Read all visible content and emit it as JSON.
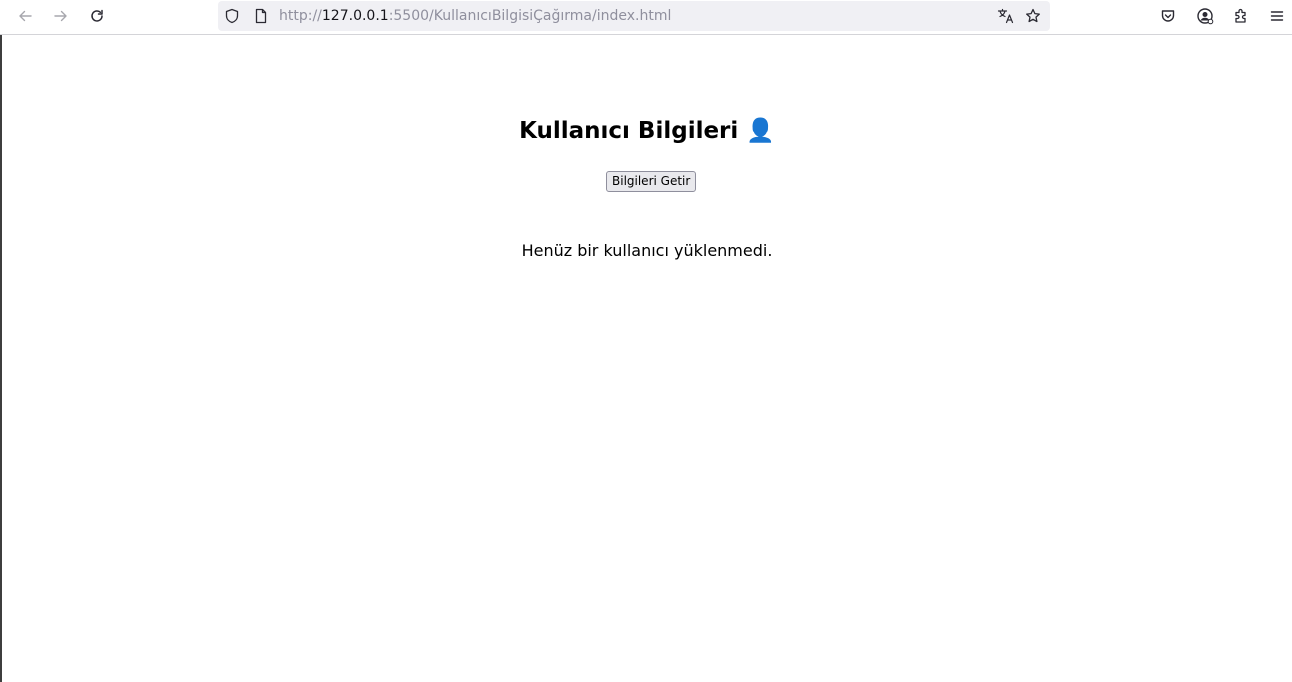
{
  "browser": {
    "url_prefix": "http://",
    "url_host": "127.0.0.1",
    "url_rest": ":5500/KullanıcıBilgisiÇağırma/index.html"
  },
  "toolbar_icons": [
    "back-icon",
    "forward-icon",
    "reload-icon",
    "shield-icon",
    "page-icon",
    "translate-icon",
    "bookmark-star-icon",
    "pocket-icon",
    "account-icon",
    "extensions-icon",
    "menu-icon"
  ],
  "page": {
    "title": "Kullanıcı Bilgileri",
    "title_icon": "👤",
    "fetch_button": "Bilgileri Getir",
    "status": "Henüz bir kullanıcı yüklenmedi."
  },
  "colors": {
    "urlbar_bg": "#f0f0f4",
    "title_icon": "#3a7bd5"
  }
}
